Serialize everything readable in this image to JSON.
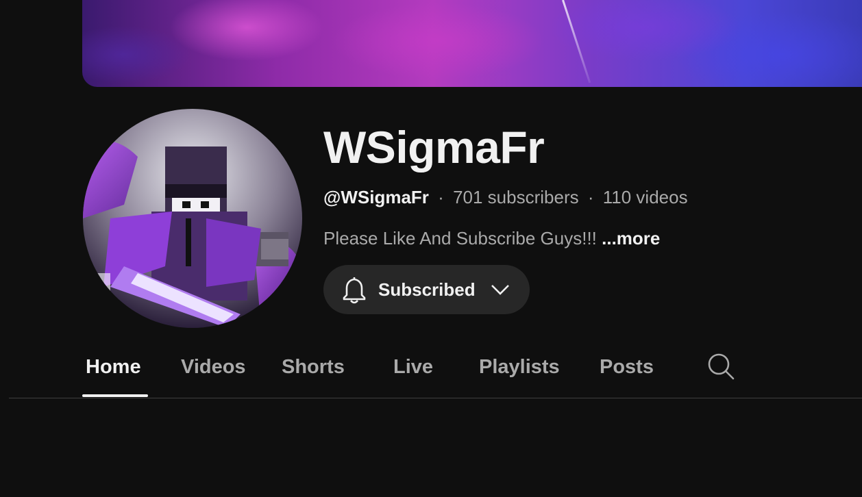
{
  "channel": {
    "name": "WSigmaFr",
    "handle": "@WSigmaFr",
    "separator": "·",
    "subscribers": "701 subscribers",
    "videos": "110 videos",
    "description": "Please Like And Subscribe Guys!!!",
    "more_label": "...more"
  },
  "subscribe_button": {
    "label": "Subscribed",
    "icon": "bell-icon",
    "dropdown_icon": "chevron-down-icon"
  },
  "tabs": [
    {
      "label": "Home",
      "active": true
    },
    {
      "label": "Videos",
      "active": false
    },
    {
      "label": "Shorts",
      "active": false
    },
    {
      "label": "Live",
      "active": false
    },
    {
      "label": "Playlists",
      "active": false
    },
    {
      "label": "Posts",
      "active": false
    }
  ],
  "tab_search_icon": "search-icon",
  "colors": {
    "background": "#0f0f0f",
    "text_primary": "#f1f1f1",
    "text_secondary": "#aaaaaa",
    "button_bg": "#272727",
    "divider": "#3f3f3f"
  }
}
